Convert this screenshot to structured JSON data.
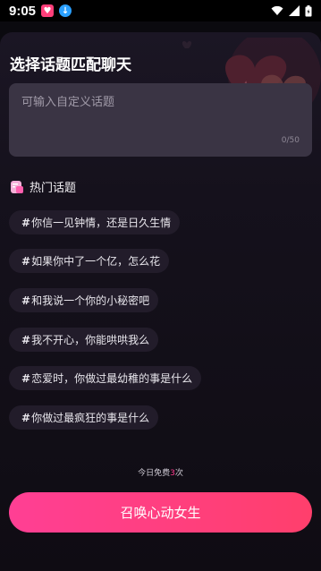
{
  "status_bar": {
    "time": "9:05",
    "apps": [
      "heart-app-icon",
      "download-icon"
    ],
    "indicators": [
      "wifi-icon",
      "signal-icon",
      "battery-icon"
    ]
  },
  "page": {
    "title": "选择话题匹配聊天"
  },
  "topic_input": {
    "placeholder": "可输入自定义话题",
    "value": "",
    "counter": "0/50"
  },
  "hot": {
    "label": "热门话题",
    "items": [
      {
        "hash": "#",
        "text": "你信一见钟情，还是日久生情"
      },
      {
        "hash": "#",
        "text": "如果你中了一个亿，怎么花"
      },
      {
        "hash": "#",
        "text": "和我说一个你的小秘密吧"
      },
      {
        "hash": "#",
        "text": "我不开心，你能哄哄我么"
      },
      {
        "hash": "#",
        "text": "恋爱时，你做过最幼稚的事是什么"
      },
      {
        "hash": "#",
        "text": "你做过最疯狂的事是什么"
      }
    ]
  },
  "free": {
    "prefix": "今日免费",
    "count": "3",
    "suffix": "次"
  },
  "cta": {
    "label": "召唤心动女生"
  },
  "colors": {
    "accent": "#ff3f94",
    "chip_bg": "#221c2a",
    "input_bg": "#3a3444"
  }
}
